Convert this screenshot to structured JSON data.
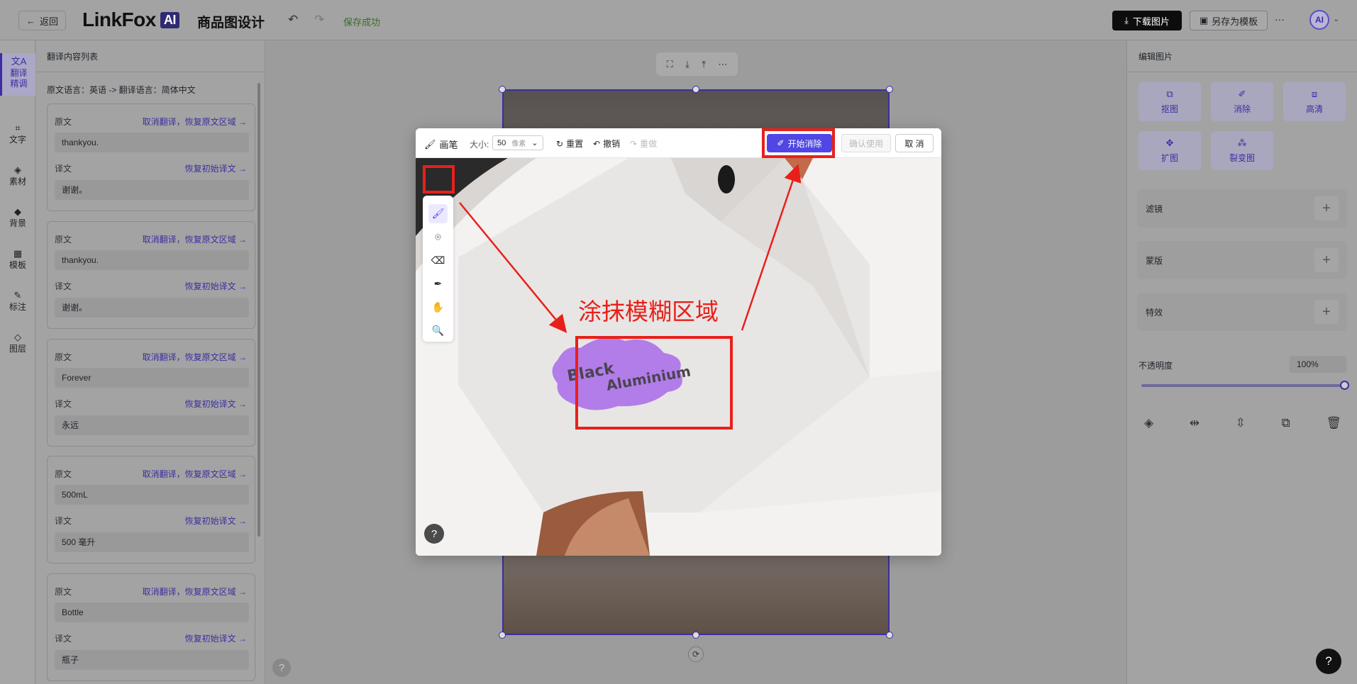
{
  "topbar": {
    "back_label": "返回",
    "logo_text": "LinkFox",
    "logo_badge": "AI",
    "page_title": "商品图设计",
    "save_status": "保存成功",
    "download_label": "下载图片",
    "save_template_label": "另存为模板",
    "more_label": "···",
    "avatar_text": "AI"
  },
  "rail": {
    "items": [
      {
        "label": "翻译\n精调",
        "icon": "translate-icon"
      },
      {
        "label": "文字",
        "icon": "text-icon"
      },
      {
        "label": "素材",
        "icon": "assets-icon"
      },
      {
        "label": "背景",
        "icon": "background-icon"
      },
      {
        "label": "模板",
        "icon": "template-icon"
      },
      {
        "label": "标注",
        "icon": "annotate-icon"
      },
      {
        "label": "图层",
        "icon": "layers-icon"
      }
    ]
  },
  "translation_panel": {
    "title": "翻译内容列表",
    "language_line": "原文语言：英语 -> 翻译语言：简体中文",
    "source_label": "原文",
    "target_label": "译文",
    "cancel_action": "取消翻译，恢复原文区域 →",
    "restore_action": "恢复初始译文 →",
    "cards": [
      {
        "source": "thankyou.",
        "target": "谢谢。"
      },
      {
        "source": "thankyou.",
        "target": "谢谢。"
      },
      {
        "source": "Forever",
        "target": "永远"
      },
      {
        "source": "500mL",
        "target": "500 毫升"
      },
      {
        "source": "Bottle",
        "target": "瓶子"
      }
    ]
  },
  "right_panel": {
    "title": "编辑图片",
    "tools": [
      {
        "label": "抠图",
        "icon": "cutout-icon"
      },
      {
        "label": "消除",
        "icon": "erase-icon"
      },
      {
        "label": "高清",
        "icon": "hd-icon"
      },
      {
        "label": "扩图",
        "icon": "expand-icon"
      },
      {
        "label": "裂变图",
        "icon": "variation-icon"
      }
    ],
    "sections": [
      {
        "label": "滤镜"
      },
      {
        "label": "蒙版"
      },
      {
        "label": "特效"
      }
    ],
    "opacity_label": "不透明度",
    "opacity_value": "100%",
    "opacity_fraction": 1.0
  },
  "modal": {
    "brush_label": "画笔",
    "size_label": "大小:",
    "size_value": "50",
    "size_unit": "像素",
    "reset_label": "重置",
    "undo_label": "撤销",
    "redo_label": "重做",
    "start_label": "开始消除",
    "confirm_label": "确认使用",
    "cancel_label": "取 消",
    "help_label": "?",
    "image_text_line1": "Black",
    "image_text_line2": "Aluminium"
  },
  "annotation": {
    "text": "涂抹模糊区域",
    "color": "#e8201a"
  },
  "help_label": "?",
  "colors": {
    "accent": "#4f46e5",
    "brand": "#3a2fa0",
    "annotation_red": "#e8201a"
  }
}
